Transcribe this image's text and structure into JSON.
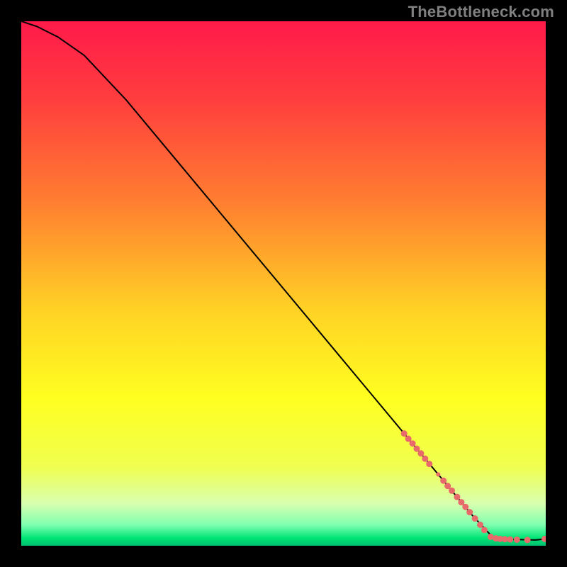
{
  "attribution": "TheBottleneck.com",
  "chart_data": {
    "type": "line",
    "title": "",
    "xlabel": "",
    "ylabel": "",
    "xlim": [
      0,
      100
    ],
    "ylim": [
      0,
      100
    ],
    "background_gradient": {
      "stops": [
        {
          "offset": 0.0,
          "color": "#ff1a4a"
        },
        {
          "offset": 0.15,
          "color": "#ff3e3e"
        },
        {
          "offset": 0.35,
          "color": "#ff8030"
        },
        {
          "offset": 0.55,
          "color": "#ffd225"
        },
        {
          "offset": 0.72,
          "color": "#ffff20"
        },
        {
          "offset": 0.85,
          "color": "#f0ff50"
        },
        {
          "offset": 0.92,
          "color": "#d8ffb0"
        },
        {
          "offset": 0.96,
          "color": "#80ffb0"
        },
        {
          "offset": 0.985,
          "color": "#00e676"
        },
        {
          "offset": 1.0,
          "color": "#00c070"
        }
      ]
    },
    "series": [
      {
        "name": "curve",
        "type": "line",
        "color": "#000000",
        "x": [
          0,
          3,
          7,
          12,
          20,
          30,
          40,
          50,
          60,
          70,
          78,
          82,
          86,
          90,
          94,
          98,
          100
        ],
        "y": [
          100,
          99,
          97,
          93.5,
          85,
          73,
          61,
          49,
          37,
          25,
          15.4,
          10.6,
          5.8,
          1.5,
          1.2,
          1.1,
          1.3
        ]
      },
      {
        "name": "markers",
        "type": "scatter",
        "color": "#e86a6a",
        "points": [
          {
            "x": 73.0,
            "y": 21.4,
            "r": 4.5
          },
          {
            "x": 73.8,
            "y": 20.4,
            "r": 4.5
          },
          {
            "x": 74.6,
            "y": 19.5,
            "r": 4.5
          },
          {
            "x": 75.4,
            "y": 18.5,
            "r": 4.5
          },
          {
            "x": 76.2,
            "y": 17.6,
            "r": 4.5
          },
          {
            "x": 77.0,
            "y": 16.6,
            "r": 4.5
          },
          {
            "x": 77.8,
            "y": 15.6,
            "r": 4.5
          },
          {
            "x": 79.5,
            "y": 13.6,
            "r": 3.0
          },
          {
            "x": 80.5,
            "y": 12.4,
            "r": 4.5
          },
          {
            "x": 81.3,
            "y": 11.4,
            "r": 4.5
          },
          {
            "x": 82.1,
            "y": 10.5,
            "r": 4.5
          },
          {
            "x": 83.1,
            "y": 9.3,
            "r": 4.5
          },
          {
            "x": 83.9,
            "y": 8.3,
            "r": 4.5
          },
          {
            "x": 84.7,
            "y": 7.4,
            "r": 4.5
          },
          {
            "x": 85.5,
            "y": 6.4,
            "r": 4.5
          },
          {
            "x": 86.5,
            "y": 5.2,
            "r": 4.5
          },
          {
            "x": 87.5,
            "y": 4.0,
            "r": 4.5
          },
          {
            "x": 88.3,
            "y": 3.0,
            "r": 4.5
          },
          {
            "x": 89.5,
            "y": 1.7,
            "r": 4.5
          },
          {
            "x": 90.5,
            "y": 1.4,
            "r": 4.5
          },
          {
            "x": 91.3,
            "y": 1.3,
            "r": 4.5
          },
          {
            "x": 92.2,
            "y": 1.25,
            "r": 4.5
          },
          {
            "x": 93.2,
            "y": 1.2,
            "r": 4.5
          },
          {
            "x": 94.5,
            "y": 1.15,
            "r": 4.5
          },
          {
            "x": 96.5,
            "y": 1.1,
            "r": 4.5
          },
          {
            "x": 99.8,
            "y": 1.3,
            "r": 4.5
          }
        ]
      }
    ]
  }
}
